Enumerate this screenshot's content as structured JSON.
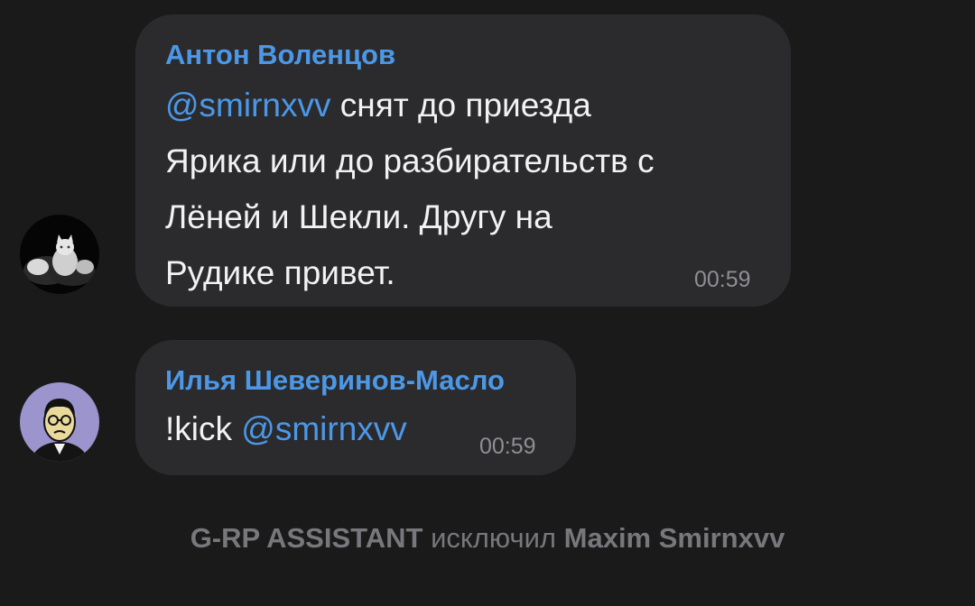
{
  "messages": [
    {
      "sender": "Антон Воленцов",
      "mention": "@smirnxvv",
      "line1_rest": " снят до приезда",
      "line2": "Ярика или до разбирательств с",
      "line3": "Лёней и Шекли. Другу на",
      "line4": "Рудике привет.",
      "time": "00:59",
      "avatar": "cat-avatar"
    },
    {
      "sender": "Илья Шеверинов-Масло",
      "command": "!kick ",
      "mention": "@smirnxvv",
      "time": "00:59",
      "avatar": "cartoon-man-avatar"
    }
  ],
  "service_message": {
    "actor": "G-RP ASSISTANT",
    "action": " исключил ",
    "target": "Maxim Smirnxvv"
  },
  "colors": {
    "background": "#1a1a1b",
    "bubble": "#2b2b2e",
    "accent": "#4c98e6",
    "time": "#8e8e93",
    "service": "#77777c"
  }
}
